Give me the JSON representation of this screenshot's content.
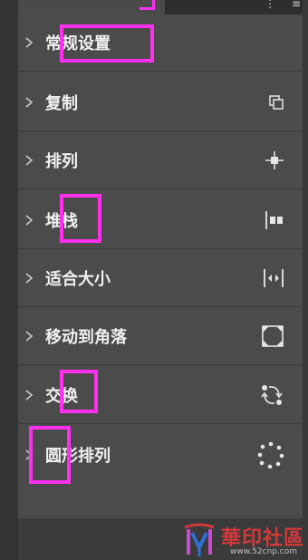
{
  "panel": {
    "items": [
      {
        "label": "常规设置",
        "icon": "none"
      },
      {
        "label": "复制",
        "icon": "duplicate-icon"
      },
      {
        "label": "排列",
        "icon": "arrange-move-icon"
      },
      {
        "label": "堆栈",
        "icon": "stack-icon"
      },
      {
        "label": "适合大小",
        "icon": "fit-size-icon"
      },
      {
        "label": "移动到角落",
        "icon": "move-to-corner-icon"
      },
      {
        "label": "交换",
        "icon": "swap-icon"
      },
      {
        "label": "圆形排列",
        "icon": "circular-arrange-icon"
      }
    ]
  },
  "colors": {
    "panel_bg": "#4b4b4b",
    "text": "#f0f0f0",
    "highlight": "#ff2ff0",
    "icon": "#e6e6e6"
  },
  "watermark": {
    "text": "華印社區",
    "url": "www.52cnp.com"
  }
}
